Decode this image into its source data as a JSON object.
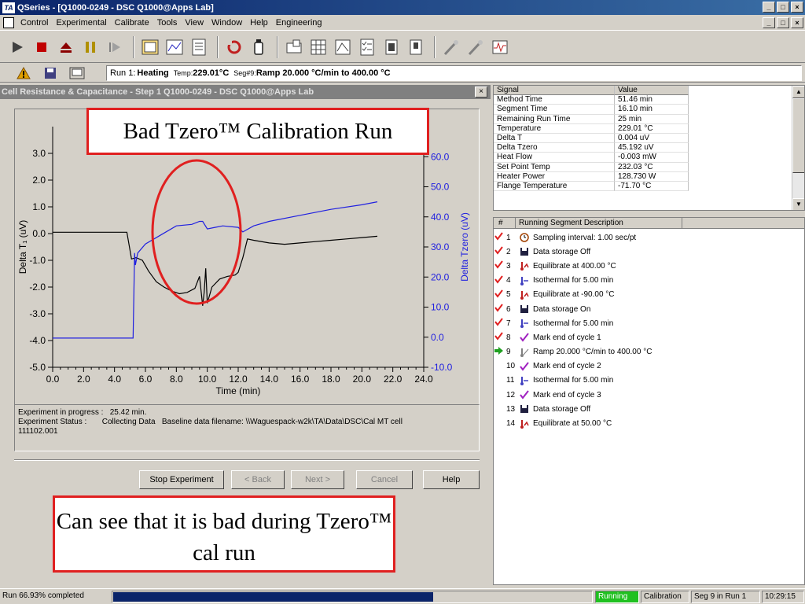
{
  "window": {
    "title": "QSeries - [Q1000-0249 - DSC Q1000@Apps Lab]",
    "app_icon_text": "TA"
  },
  "menu": [
    "Control",
    "Experimental",
    "Calibrate",
    "Tools",
    "View",
    "Window",
    "Help",
    "Engineering"
  ],
  "run_info": {
    "run_label": "Run 1:",
    "run_value": "Heating",
    "temp_label": "Temp:",
    "temp_value": "229.01°C",
    "seg_label": "Seg#9:",
    "seg_value": "Ramp 20.000 °C/min to 400.00 °C"
  },
  "panel": {
    "title": "Cell Resistance & Capacitance - Step 1  Q1000-0249 - DSC Q1000@Apps Lab",
    "close_glyph": "×"
  },
  "chart_data": {
    "type": "line",
    "xlabel": "Time (min)",
    "ylabel_left": "Delta T₁ (uV)",
    "ylabel_right": "Delta Tzero (uV)",
    "xlim": [
      0,
      24
    ],
    "ylim_left": [
      -5,
      4
    ],
    "ylim_right": [
      -10,
      70
    ],
    "x_ticks": [
      "0.0",
      "2.0",
      "4.0",
      "6.0",
      "8.0",
      "10.0",
      "12.0",
      "14.0",
      "16.0",
      "18.0",
      "20.0",
      "22.0",
      "24.0"
    ],
    "y_left_ticks": [
      "3.0",
      "2.0",
      "1.0",
      "0.0",
      "-1.0",
      "-2.0",
      "-3.0",
      "-4.0",
      "-5.0"
    ],
    "y_right_ticks": [
      "60.0",
      "50.0",
      "40.0",
      "30.0",
      "20.0",
      "10.0",
      "0.0",
      "-10.0"
    ],
    "series": [
      {
        "color": "#000000",
        "axis": "left",
        "x": [
          0.0,
          2.0,
          4.0,
          4.8,
          5.1,
          5.4,
          5.8,
          6.2,
          6.7,
          7.2,
          7.7,
          8.2,
          8.7,
          9.2,
          9.5,
          9.7,
          9.8,
          9.9,
          10.0,
          10.3,
          10.8,
          11.3,
          11.8,
          12.0,
          12.3,
          12.6,
          13.0,
          14.0,
          15.0,
          16.0,
          17.0,
          18.0,
          19.0,
          20.0,
          21.0
        ],
        "y": [
          0.05,
          0.05,
          0.05,
          0.05,
          -0.95,
          -0.9,
          -1.0,
          -1.4,
          -1.8,
          -2.0,
          -2.15,
          -2.25,
          -2.2,
          -2.05,
          -1.6,
          -2.7,
          -2.2,
          -1.3,
          -2.6,
          -2.0,
          -1.7,
          -1.6,
          -1.55,
          -1.45,
          -0.9,
          -0.2,
          -0.25,
          -0.35,
          -0.4,
          -0.35,
          -0.3,
          -0.25,
          -0.2,
          -0.15,
          -0.1
        ]
      },
      {
        "color": "#2020e0",
        "axis": "right",
        "x": [
          0.0,
          2.0,
          4.0,
          5.2,
          5.3,
          5.35,
          5.5,
          6.0,
          7.0,
          8.0,
          9.0,
          9.5,
          9.7,
          10.0,
          10.5,
          11.0,
          12.0,
          12.3,
          13.0,
          14.0,
          16.0,
          18.0,
          20.0,
          21.0
        ],
        "y": [
          -0.3,
          -0.3,
          -0.3,
          -0.3,
          28,
          24,
          28,
          31,
          34,
          37,
          37.5,
          38.5,
          38.5,
          36,
          36.5,
          37,
          36.5,
          35,
          37,
          38.5,
          40.5,
          42.5,
          44,
          45
        ]
      }
    ]
  },
  "annotations": {
    "top": "Bad Tzero™ Calibration Run",
    "bottom": "Can see that it is bad during Tzero™ cal run"
  },
  "experiment": {
    "progress_label": "Experiment in progress :",
    "progress_value": "25.42 min.",
    "status_label": "Experiment Status :",
    "status_value": "Collecting Data",
    "baseline_text": "Baseline data filename: \\\\Waguespack-w2k\\TA\\Data\\DSC\\Cal MT cell",
    "baseline_text2": "111102.001"
  },
  "buttons": {
    "stop": "Stop Experiment",
    "back": "< Back",
    "next": "Next >",
    "cancel": "Cancel",
    "help": "Help"
  },
  "signal_table": {
    "headers": [
      "Signal",
      "Value"
    ],
    "rows": [
      [
        "Method Time",
        "51.46 min"
      ],
      [
        "Segment Time",
        "16.10 min"
      ],
      [
        "Remaining Run Time",
        "25 min"
      ],
      [
        "Temperature",
        "229.01 °C"
      ],
      [
        "Delta T",
        "0.004 uV"
      ],
      [
        "Delta Tzero",
        "45.192 uV"
      ],
      [
        "Heat Flow",
        "-0.003 mW"
      ],
      [
        "Set Point Temp",
        "232.03 °C"
      ],
      [
        "Heater Power",
        "128.730 W"
      ],
      [
        "Flange Temperature",
        "-71.70 °C"
      ]
    ]
  },
  "segment_table": {
    "headers": [
      "#",
      "Running Segment Description"
    ],
    "rows": [
      {
        "num": "1",
        "status": "done",
        "icon": "clock",
        "text": "Sampling interval: 1.00 sec/pt"
      },
      {
        "num": "2",
        "status": "done",
        "icon": "disk",
        "text": "Data storage Off"
      },
      {
        "num": "3",
        "status": "done",
        "icon": "thermo-up",
        "text": "Equilibrate at 400.00 °C"
      },
      {
        "num": "4",
        "status": "done",
        "icon": "thermo-right",
        "text": "Isothermal for 5.00 min"
      },
      {
        "num": "5",
        "status": "done",
        "icon": "thermo-up",
        "text": "Equilibrate at -90.00 °C"
      },
      {
        "num": "6",
        "status": "done",
        "icon": "disk",
        "text": "Data storage On"
      },
      {
        "num": "7",
        "status": "done",
        "icon": "thermo-right",
        "text": "Isothermal for 5.00 min"
      },
      {
        "num": "8",
        "status": "done",
        "icon": "checkmark",
        "text": "Mark end of cycle 1"
      },
      {
        "num": "9",
        "status": "current",
        "icon": "ramp",
        "text": "Ramp 20.000 °C/min to 400.00 °C"
      },
      {
        "num": "10",
        "status": "pending",
        "icon": "checkmark",
        "text": "Mark end of cycle 2"
      },
      {
        "num": "11",
        "status": "pending",
        "icon": "thermo-right",
        "text": "Isothermal for 5.00 min"
      },
      {
        "num": "12",
        "status": "pending",
        "icon": "checkmark",
        "text": "Mark end of cycle 3"
      },
      {
        "num": "13",
        "status": "pending",
        "icon": "disk",
        "text": "Data storage Off"
      },
      {
        "num": "14",
        "status": "pending",
        "icon": "thermo-up",
        "text": "Equilibrate at 50.00 °C"
      }
    ]
  },
  "statusbar": {
    "progress_text": "Run 66.93% completed",
    "progress_fraction": 0.6693,
    "state": "Running",
    "mode": "Calibration",
    "seg": "Seg  9 in Run  1",
    "time": "10:29:15",
    "state_color": "#20c020"
  }
}
